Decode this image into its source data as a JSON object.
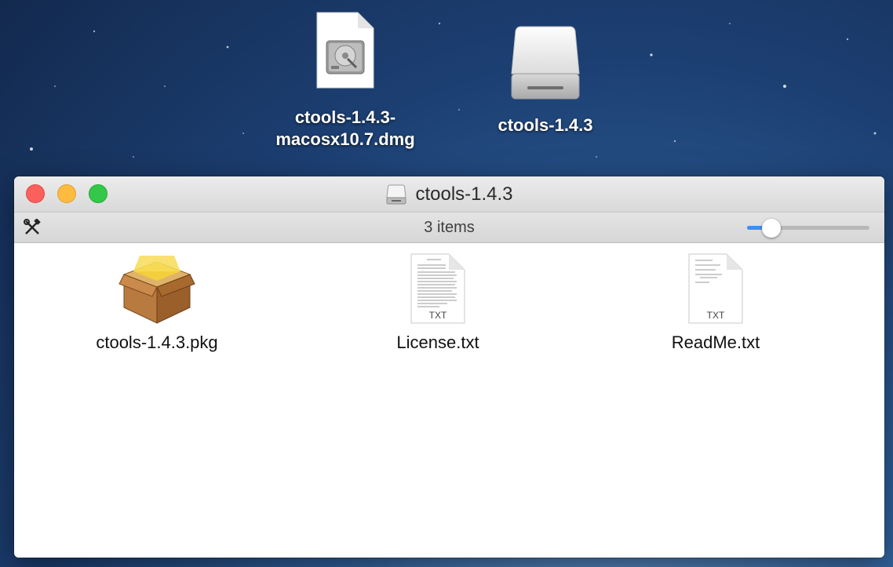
{
  "desktop": {
    "icons": [
      {
        "label_line1": "ctools-1.4.3-",
        "label_line2": "macosx10.7.dmg",
        "icon": "dmg-disk-image-icon"
      },
      {
        "label": "ctools-1.4.3",
        "icon": "external-volume-icon"
      }
    ]
  },
  "window": {
    "title": "ctools-1.4.3",
    "title_icon": "volume-icon",
    "status": "3 items",
    "icon_size_slider_level": 0.2,
    "items": [
      {
        "label": "ctools-1.4.3.pkg",
        "icon": "package-icon"
      },
      {
        "label": "License.txt",
        "icon": "text-document-icon",
        "badge": "TXT"
      },
      {
        "label": "ReadMe.txt",
        "icon": "text-document-icon",
        "badge": "TXT"
      }
    ]
  },
  "colors": {
    "close": "#fc605c",
    "minimize": "#fdbc40",
    "zoom": "#34c84a",
    "slider_accent": "#3d8ff2"
  }
}
